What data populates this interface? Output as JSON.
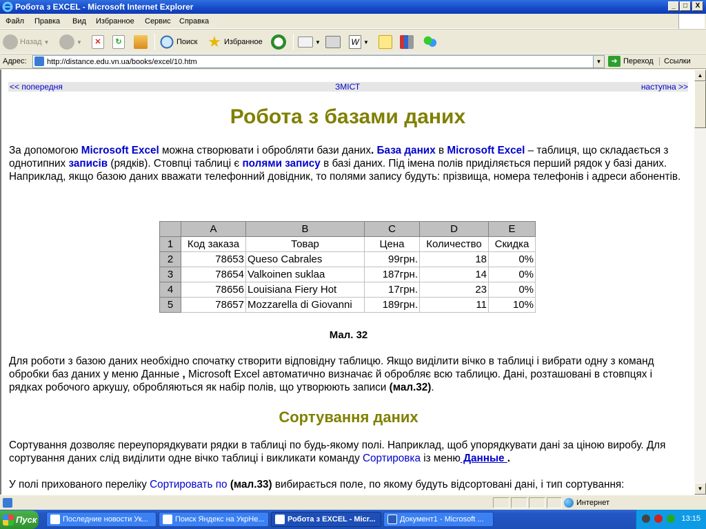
{
  "window": {
    "title": "Робота з EXCEL - Microsoft Internet Explorer",
    "controls": {
      "minimize": "_",
      "maximize": "□",
      "close": "X"
    }
  },
  "menu": [
    "Файл",
    "Правка",
    "Вид",
    "Избранное",
    "Сервис",
    "Справка"
  ],
  "toolbar": {
    "back_label": "Назад",
    "search_label": "Поиск",
    "favorites_label": "Избранное"
  },
  "address": {
    "label": "Адрес:",
    "url": "http://distance.edu.vn.ua/books/excel/10.htm",
    "go_label": "Переход",
    "links_label": "Ссылки"
  },
  "page": {
    "nav": {
      "prev": "<< попередня",
      "toc": "ЗМІСТ",
      "next": "наступна >>"
    },
    "title": "Робота з базами даних",
    "intro": {
      "t1": "За допомогою ",
      "k1": "Microsoft Excel",
      "t2": " можна створювати і обробляти бази даних",
      "t2b": ". ",
      "k2": "База даних",
      "t3": " в ",
      "k3": "Microsoft Excel",
      "t4": " – таблиця, що складається з однотипних ",
      "k4": "записів",
      "t5": " (рядків). Стовпці таблиці є ",
      "k5": "полями запису",
      "t6": " в базі даних. Під імена полів приділяється перший рядок у базі даних. Наприклад, якщо базою даних вважати телефонний довідник, то полями запису будуть: прізвища, номера телефонів і адреси абонентів."
    },
    "figure": {
      "col_headers": [
        "A",
        "B",
        "C",
        "D",
        "E"
      ],
      "row_numbers": [
        "1",
        "2",
        "3",
        "4",
        "5"
      ],
      "header_row": [
        "Код заказа",
        "Товар",
        "Цена",
        "Количество",
        "Скидка"
      ],
      "rows": [
        [
          "78653",
          "Queso Cabrales",
          "99грн.",
          "18",
          "0%"
        ],
        [
          "78654",
          "Valkoinen suklaa",
          "187грн.",
          "14",
          "0%"
        ],
        [
          "78656",
          "Louisiana Fiery Hot",
          "17грн.",
          "23",
          "0%"
        ],
        [
          "78657",
          "Mozzarella di Giovanni",
          "189грн.",
          "11",
          "10%"
        ]
      ],
      "caption": "Мал. 32"
    },
    "para2": {
      "t1": "Для роботи з базою даних необхідно спочатку створити відповідну таблицю. Якщо виділити вічко в таблиці і вибрати одну з команд обробки баз даних у меню Данные ",
      "t1b": ",",
      "t2": " Microsoft Excel автоматично визначає й обробляє всю таблицю. Дані, розташовані в стовпцях і рядках робочого аркушу, обробляються як набір полів, що утворюють записи ",
      "ref": "(мал.32)",
      "t3": "."
    },
    "section_title": "Сортування даних",
    "para3": {
      "t1": "Сортування дозволяє переупорядкувати рядки в таблиці по будь-якому полі. Наприклад, щоб упорядкувати дані за ціною виробу. Для сортування даних слід виділити одне вічко таблиці і викликати команду ",
      "l1": "Сортировка",
      "t2": " із меню",
      "l2": " Данные ",
      "t3": "."
    },
    "para4": {
      "t1": "У полі прихованого переліку ",
      "l1": "Сортировать по",
      "t2": " ",
      "ref": "(мал.33)",
      "t3": " вибирається поле, по якому будуть відсортовані дані, і тип сортування:"
    }
  },
  "status": {
    "zone": "Интернет"
  },
  "taskbar": {
    "start": "Пуск",
    "tasks": [
      "Последние новости Ук...",
      "Поиск Яндекс на УкрНе...",
      "Робота з EXCEL - Micr...",
      "Документ1 - Microsoft ..."
    ],
    "clock": "13:15"
  },
  "colors": {
    "heading": "#808000",
    "link": "#0000cc"
  }
}
